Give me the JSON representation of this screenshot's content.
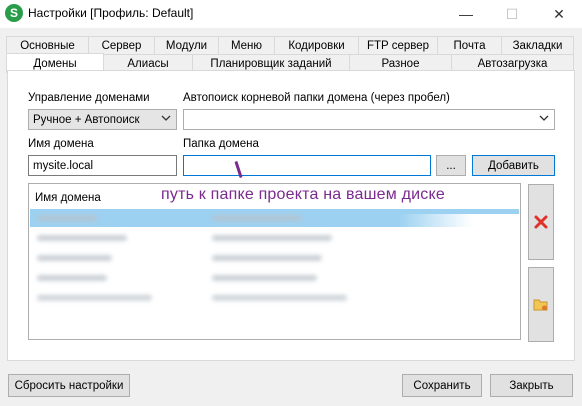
{
  "window": {
    "title": "Настройки [Профиль: Default]",
    "app_icon_letter": "S",
    "min_glyph": "—",
    "max_glyph": "☐",
    "close_glyph": "✕"
  },
  "tabs_row1": [
    {
      "label": "Основные"
    },
    {
      "label": "Сервер"
    },
    {
      "label": "Модули"
    },
    {
      "label": "Меню"
    },
    {
      "label": "Кодировки"
    },
    {
      "label": "FTP сервер"
    },
    {
      "label": "Почта"
    },
    {
      "label": "Закладки"
    }
  ],
  "tabs_row2": [
    {
      "label": "Домены",
      "active": true
    },
    {
      "label": "Алиасы"
    },
    {
      "label": "Планировщик заданий"
    },
    {
      "label": "Разное"
    },
    {
      "label": "Автозагрузка"
    }
  ],
  "domain_management": {
    "label": "Управление доменами",
    "value": "Ручное + Автопоиск"
  },
  "autosearch": {
    "label": "Автопоиск корневой папки домена (через пробел)",
    "value": ""
  },
  "domain_name": {
    "label": "Имя домена",
    "value": "mysite.local"
  },
  "domain_folder": {
    "label": "Папка домена",
    "value": ""
  },
  "browse_button": "...",
  "add_button": "Добавить",
  "annotation": "путь к папке проекта на вашем диске",
  "list": {
    "col_domain": "Имя домена",
    "col_folder": "",
    "rows": 5
  },
  "footer": {
    "reset": "Сбросить настройки",
    "save": "Сохранить",
    "close": "Закрыть"
  },
  "icons": {
    "delete": "delete-x-icon",
    "folder": "folder-icon"
  },
  "colors": {
    "selected_row": "#9dd1f1",
    "annotation": "#7b2a8f",
    "delete_red": "#e0322b",
    "accent": "#0078d7"
  }
}
